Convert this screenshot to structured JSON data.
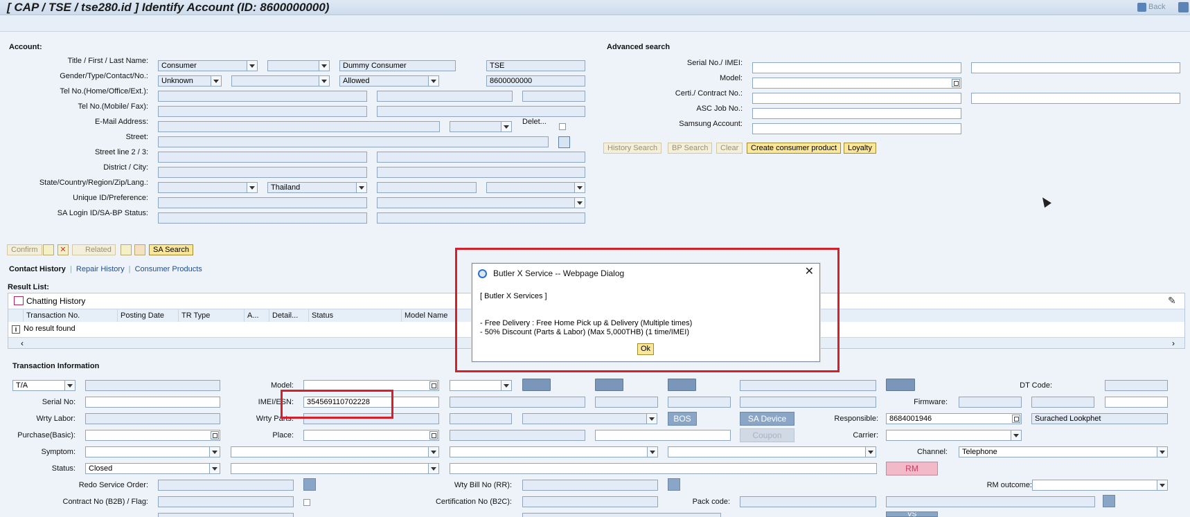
{
  "header": {
    "title": "[ CAP / TSE / tse280.id ] Identify Account (ID: 8600000000)",
    "back": "Back"
  },
  "account": {
    "section": "Account:",
    "labels": {
      "title_name": "Title / First / Last Name:",
      "gender": "Gender/Type/Contact/No.:",
      "tel_home": "Tel No.(Home/Office/Ext.):",
      "tel_mobile": "Tel No.(Mobile/ Fax):",
      "email": "E-Mail Address:",
      "delete": "Delet...",
      "street": "Street:",
      "street2": "Street line 2 / 3:",
      "district": "District / City:",
      "state": "State/Country/Region/Zip/Lang.:",
      "unique": "Unique ID/Preference:",
      "sa_login": "SA Login ID/SA-BP Status:"
    },
    "values": {
      "title": "Consumer",
      "first": "Dummy Consumer",
      "last": "TSE",
      "gender": "Unknown",
      "contact": "Allowed",
      "number": "8600000000",
      "country": "Thailand"
    },
    "buttons": {
      "confirm": "Confirm",
      "related": "Related",
      "sa_search": "SA Search"
    }
  },
  "advanced": {
    "section": "Advanced search",
    "labels": {
      "serial": "Serial No./ IMEI:",
      "model": "Model:",
      "certi": "Certi./ Contract No.:",
      "asc": "ASC Job No.:",
      "samsung": "Samsung Account:"
    },
    "buttons": {
      "history": "History Search",
      "bp": "BP Search",
      "clear": "Clear",
      "create": "Create consumer product",
      "loyalty": "Loyalty"
    }
  },
  "tabs": {
    "contact": "Contact History",
    "repair": "Repair History",
    "products": "Consumer Products"
  },
  "result": {
    "section": "Result List:",
    "chat": "Chatting History",
    "columns": [
      "Transaction No.",
      "Posting Date",
      "TR Type",
      "A...",
      "Detail...",
      "Status",
      "Model Name"
    ],
    "empty": "No result found"
  },
  "dialog": {
    "title": "Butler X Service -- Webpage Dialog",
    "heading": "[ Butler X Services ]",
    "line1": "- Free Delivery : Free Home Pick up & Delivery (Multiple times)",
    "line2": "- 50% Discount (Parts & Labor) (Max 5,000THB) (1 time/IMEI)",
    "ok": "Ok"
  },
  "transaction": {
    "section": "Transaction Information",
    "labels": {
      "serial": "Serial No:",
      "wrty_labor": "Wrty Labor:",
      "purchase": "Purchase(Basic):",
      "symptom": "Symptom:",
      "status": "Status:",
      "redo": "Redo Service Order:",
      "contract": "Contract No (B2B) / Flag:",
      "model": "Model:",
      "imei": "IMEI/ESN:",
      "wrty_parts": "Wrty Parts:",
      "place": "Place:",
      "wty_bill": "Wty Bill No (RR):",
      "certification": "Certification No (B2C):",
      "dt_code": "DT Code:",
      "firmware": "Firmware:",
      "responsible": "Responsible:",
      "carrier": "Carrier:",
      "channel": "Channel:",
      "rm_outcome": "RM outcome:",
      "pack": "Pack code:"
    },
    "values": {
      "ta": "T/A",
      "imei": "354569110702228",
      "status": "Closed",
      "responsible": "8684001946",
      "responsible_name": "Surached Lookphet",
      "channel": "Telephone"
    },
    "buttons": {
      "bos": "BOS",
      "sa_device": "SA Device",
      "coupon": "Coupon",
      "rm": "RM",
      "vs": "VS"
    }
  },
  "colors": {
    "highlight": "#d51f2b",
    "field": "#e3ecf6",
    "button": "#f6f0c9"
  }
}
